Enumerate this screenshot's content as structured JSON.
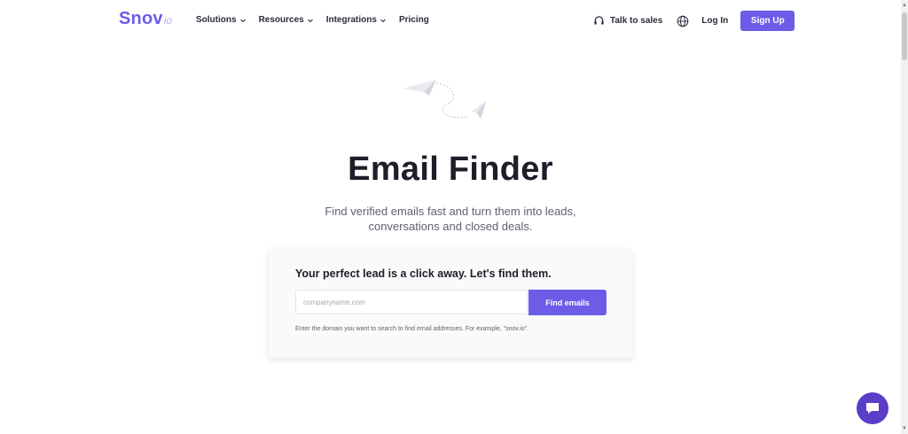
{
  "logo": {
    "main": "Snov",
    "sub": "io"
  },
  "nav": {
    "items": [
      {
        "label": "Solutions",
        "has_dropdown": true
      },
      {
        "label": "Resources",
        "has_dropdown": true
      },
      {
        "label": "Integrations",
        "has_dropdown": true
      },
      {
        "label": "Pricing",
        "has_dropdown": false
      }
    ],
    "talk_to_sales": "Talk to sales",
    "login": "Log In",
    "signup": "Sign Up"
  },
  "hero": {
    "title": "Email Finder",
    "subtitle_line1": "Find verified emails fast and turn them into leads,",
    "subtitle_line2": "conversations and closed deals."
  },
  "search_card": {
    "heading": "Your perfect lead is a click away. Let's find them.",
    "placeholder": "companyname.com",
    "button": "Find emails",
    "hint": "Enter the domain you want to search to find email addresses. For example, \"snov.io\"."
  },
  "colors": {
    "brand": "#6c5ce7",
    "chat": "#5a3ec8",
    "text": "#1e1e2a"
  },
  "icons": {
    "talk": "headset-icon",
    "language": "globe-icon",
    "chat": "chat-bubble-icon",
    "hero": "paper-plane-icon"
  }
}
